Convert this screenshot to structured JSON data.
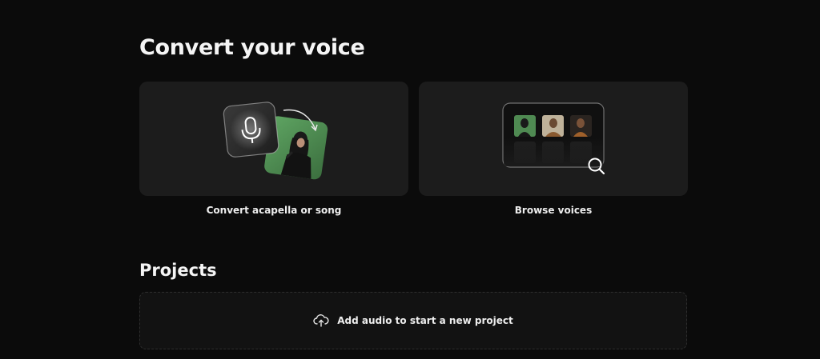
{
  "header": {
    "title": "Convert your voice"
  },
  "cards": [
    {
      "label": "Convert acapella or song",
      "icon": "microphone-to-singer-icon"
    },
    {
      "label": "Browse voices",
      "icon": "voice-grid-search-icon"
    }
  ],
  "projects": {
    "title": "Projects",
    "dropzone_label": "Add audio to start a new project",
    "dropzone_icon": "cloud-upload-icon"
  },
  "colors": {
    "background": "#0b0b0b",
    "card": "#1c1c1c",
    "accent_green": "#4d8a4f",
    "text": "#f2f2f2"
  }
}
